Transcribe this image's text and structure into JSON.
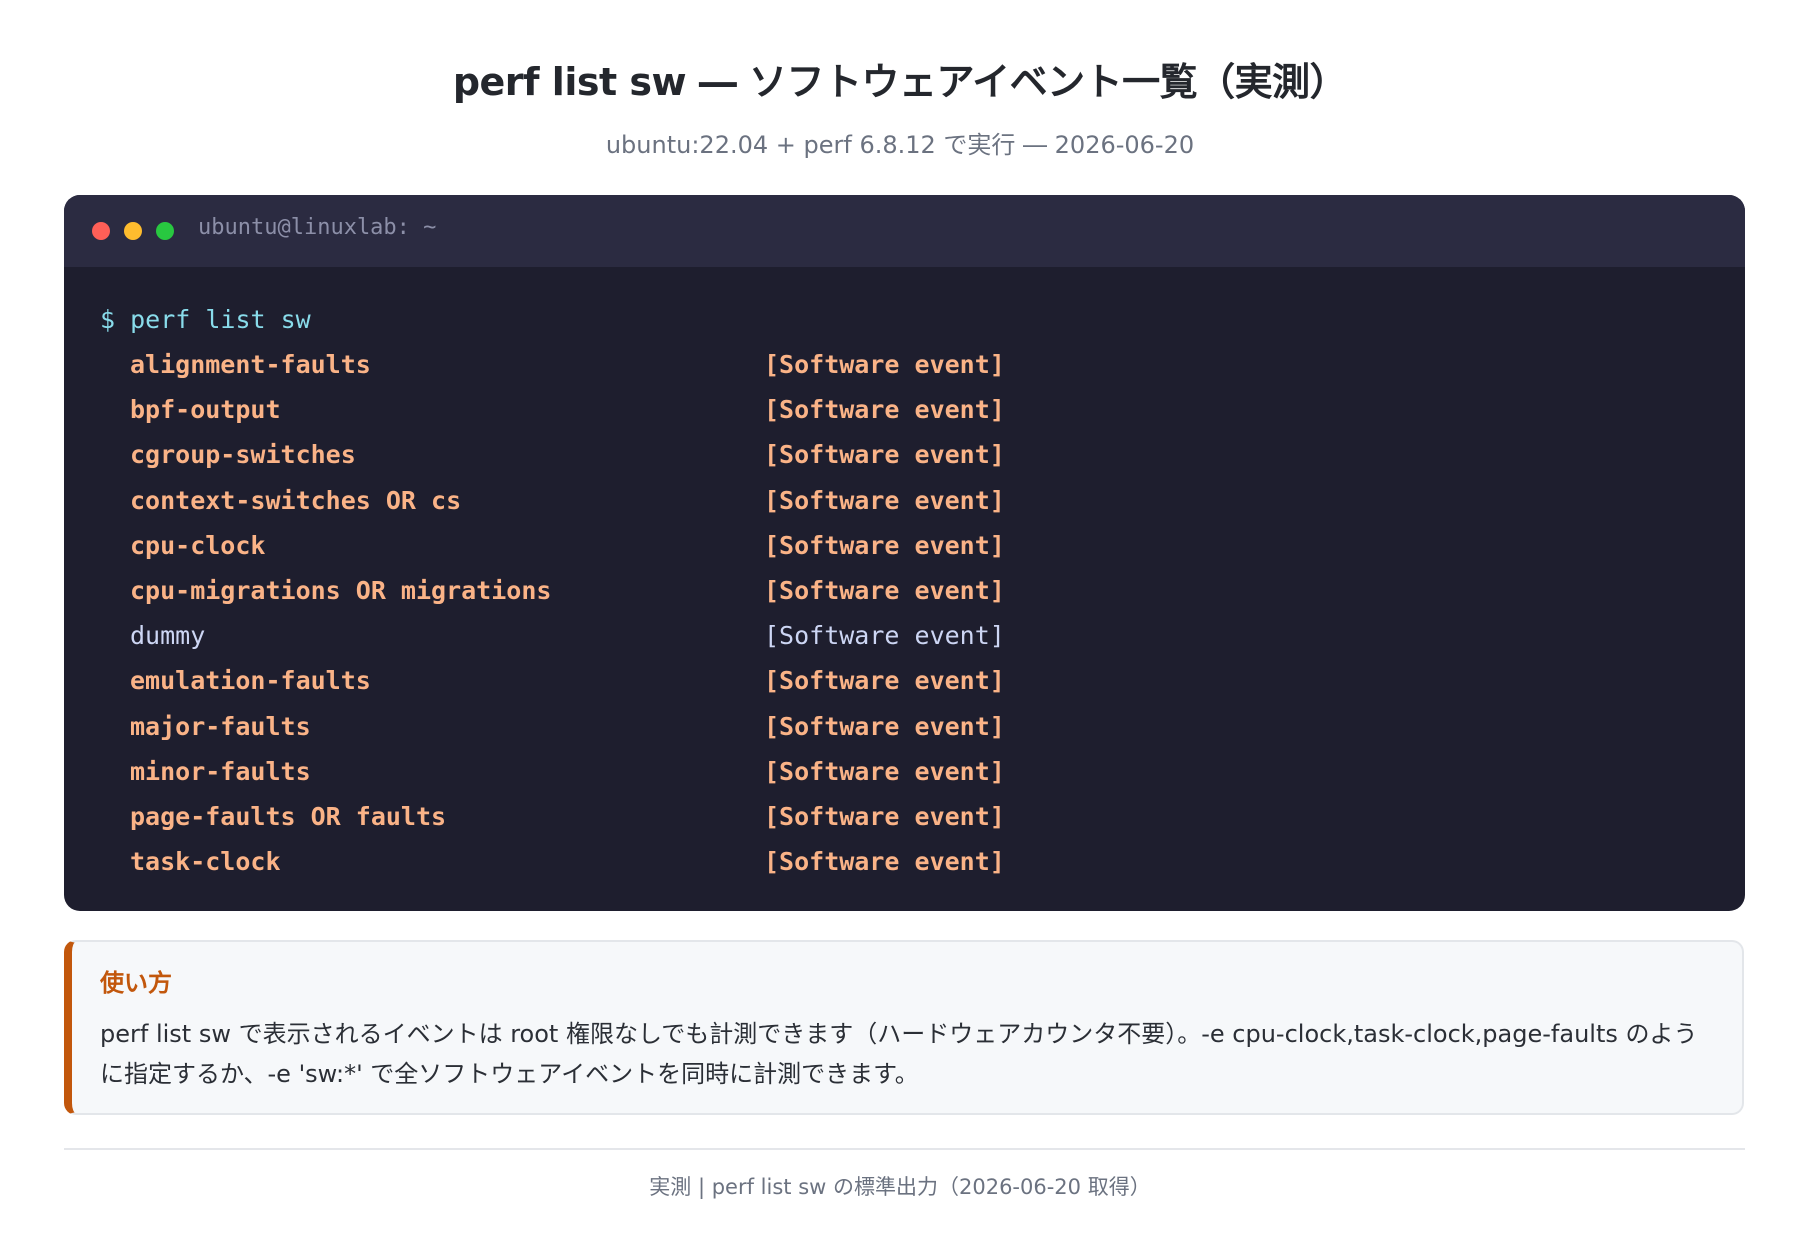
{
  "header": {
    "title": "perf list sw ― ソフトウェアイベント一覧（実測）",
    "subtitle": "ubuntu:22.04 + perf 6.8.12 で実行 ― 2026-06-20"
  },
  "terminal": {
    "window_title": "ubuntu@linuxlab: ~",
    "command": "$ perf list sw",
    "events": [
      {
        "name": "alignment-faults",
        "type": "[Software event]",
        "highlighted": true
      },
      {
        "name": "bpf-output",
        "type": "[Software event]",
        "highlighted": true
      },
      {
        "name": "cgroup-switches",
        "type": "[Software event]",
        "highlighted": true
      },
      {
        "name": "context-switches OR cs",
        "type": "[Software event]",
        "highlighted": true
      },
      {
        "name": "cpu-clock",
        "type": "[Software event]",
        "highlighted": true
      },
      {
        "name": "cpu-migrations OR migrations",
        "type": "[Software event]",
        "highlighted": true
      },
      {
        "name": "dummy",
        "type": "[Software event]",
        "highlighted": false
      },
      {
        "name": "emulation-faults",
        "type": "[Software event]",
        "highlighted": true
      },
      {
        "name": "major-faults",
        "type": "[Software event]",
        "highlighted": true
      },
      {
        "name": "minor-faults",
        "type": "[Software event]",
        "highlighted": true
      },
      {
        "name": "page-faults OR faults",
        "type": "[Software event]",
        "highlighted": true
      },
      {
        "name": "task-clock",
        "type": "[Software event]",
        "highlighted": true
      }
    ]
  },
  "note": {
    "title": "使い方",
    "text": "perf list sw で表示されるイベントは root 権限なしでも計測できます（ハードウェアカウンタ不要）。-e cpu-clock,task-clock,page-faults のように指定するか、-e 'sw:*' で全ソフトウェアイベントを同時に計測できます。"
  },
  "footer": {
    "text": "実測 | perf list sw の標準出力（2026-06-20 取得）"
  },
  "colors": {
    "terminal_bg": "#1e1e2e",
    "titlebar_bg": "#2b2b41",
    "command": "#89dceb",
    "event_highlight": "#fab387",
    "event_plain": "#cdd6f4",
    "note_accent": "#c2570c"
  }
}
